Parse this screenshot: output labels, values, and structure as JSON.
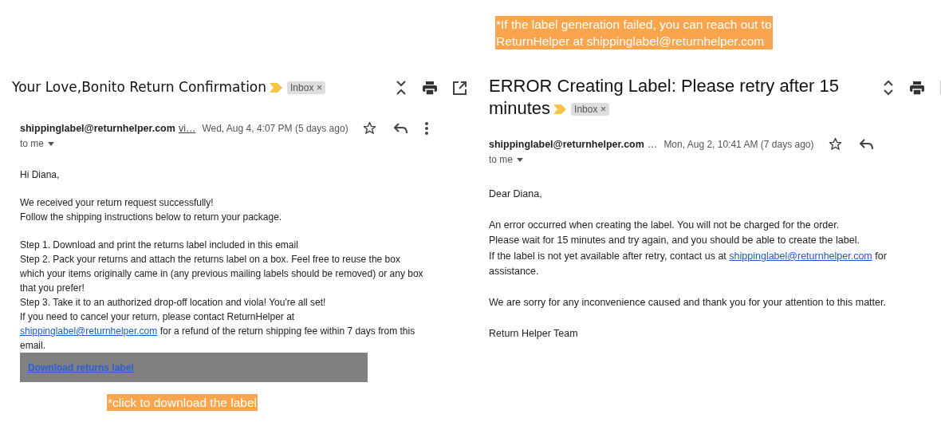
{
  "top_note": [
    "*If the label generation failed, you can reach out to",
    "ReturnHelper at shippinglabel@returnhelper.com"
  ],
  "emails": [
    {
      "subject": [
        "Your Love,Bonito Return Confirmation"
      ],
      "label": "Inbox",
      "label_close": "×",
      "actions": [
        {
          "kind": "collapse"
        },
        {
          "kind": "print"
        },
        {
          "kind": "popout"
        }
      ],
      "sender": "shippinglabel@returnhelper.com",
      "via": "vi…",
      "via_link": true,
      "date": "Wed, Aug 4, 4:07 PM (5 days ago)",
      "recipient": "to me",
      "message_actions": [
        {
          "kind": "star"
        },
        {
          "kind": "reply"
        },
        {
          "kind": "more"
        }
      ],
      "paragraphs": [
        [
          [
            {
              "kind": "text",
              "text": "Hi Diana,"
            }
          ]
        ],
        [
          [
            {
              "kind": "text",
              "text": "We received your return request successfully!"
            }
          ],
          [
            {
              "kind": "text",
              "text": "Follow the shipping instructions below to return your package."
            }
          ]
        ],
        [
          [
            {
              "kind": "text",
              "text": "Step 1. Download and print the returns label included in this email"
            }
          ],
          [
            {
              "kind": "text",
              "text": "Step 2. Pack your returns and attach the returns label on a box. Feel free to reuse the box"
            }
          ],
          [
            {
              "kind": "text",
              "text": "which your items originally came in (any previous mailing labels should be removed) or any box"
            }
          ],
          [
            {
              "kind": "text",
              "text": "that you prefer!"
            }
          ],
          [
            {
              "kind": "text",
              "text": "Step 3. Take it to an authorized drop-off location and viola! You're all set!"
            }
          ],
          [
            {
              "kind": "text",
              "text": "If you need to cancel your return, please contact ReturnHelper at"
            }
          ],
          [
            {
              "kind": "link",
              "text": "shippinglabel@returnhelper.com"
            },
            {
              "kind": "text",
              "text": " for a refund of the return shipping fee within 7 days from this"
            }
          ],
          [
            {
              "kind": "text",
              "text": "email."
            }
          ]
        ]
      ],
      "button": "Download returns label",
      "button_note": "*click to download the label"
    },
    {
      "subject": [
        "ERROR Creating Label: Please retry after 15",
        "minutes"
      ],
      "label": "Inbox",
      "label_close": "×",
      "actions": [
        {
          "kind": "expand"
        },
        {
          "kind": "print"
        },
        {
          "kind": "divider"
        }
      ],
      "sender": "shippinglabel@returnhelper.com",
      "via": "…",
      "via_link": false,
      "date": "Mon, Aug 2, 10:41 AM (7 days ago)",
      "recipient": "to me",
      "message_actions": [
        {
          "kind": "star"
        },
        {
          "kind": "reply"
        }
      ],
      "paragraphs": [
        [
          [
            {
              "kind": "text",
              "text": "Dear Diana,"
            }
          ]
        ],
        [
          [
            {
              "kind": "text",
              "text": "An error occurred when creating the label. You will not be charged for the order."
            }
          ],
          [
            {
              "kind": "text",
              "text": "Please wait for 15 minutes and try again, and you should be able to create the label."
            }
          ],
          [
            {
              "kind": "text",
              "text": "If the label is not yet available after retry, contact us at "
            },
            {
              "kind": "link",
              "text": "shippinglabel@returnhelper.com"
            },
            {
              "kind": "text",
              "text": " for"
            }
          ],
          [
            {
              "kind": "text",
              "text": "assistance."
            }
          ]
        ],
        [
          [
            {
              "kind": "text",
              "text": "We are sorry for any inconvenience caused and thank you for your attention to this matter."
            }
          ]
        ],
        [
          [
            {
              "kind": "text",
              "text": "Return Helper Team"
            }
          ]
        ]
      ]
    }
  ]
}
